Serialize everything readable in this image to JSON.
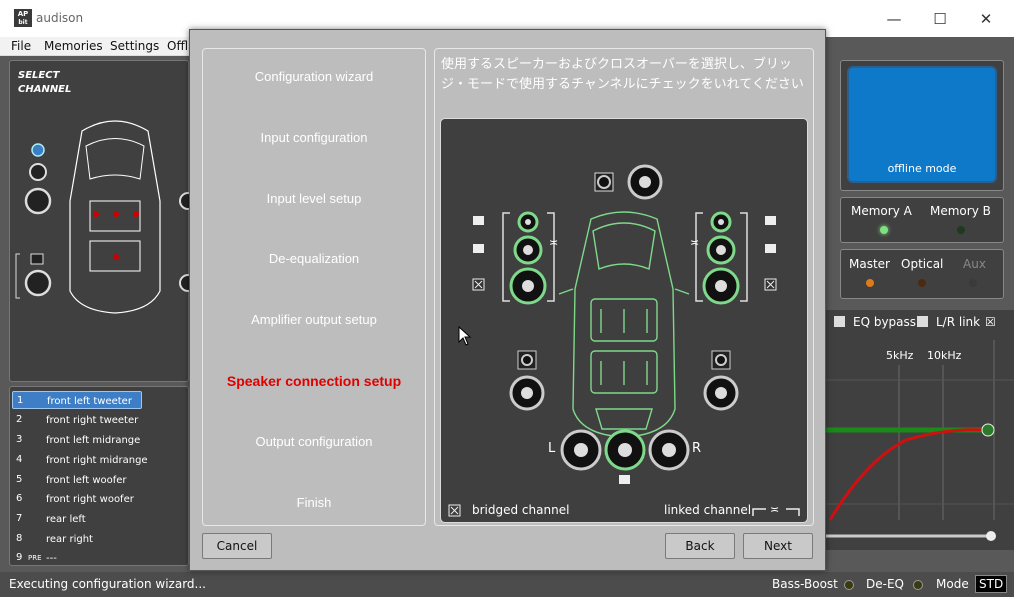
{
  "window": {
    "logo": "AP",
    "logo_sub": "bit",
    "title": "audison",
    "minimize": "—",
    "maximize": "☐",
    "close": "✕"
  },
  "menu": [
    "File",
    "Memories",
    "Settings",
    "Offli"
  ],
  "select_channel": {
    "line1": "SELECT",
    "line2": "CHANNEL"
  },
  "channels": [
    {
      "num": "1",
      "name": "front left tweeter"
    },
    {
      "num": "2",
      "name": "front right tweeter"
    },
    {
      "num": "3",
      "name": "front left midrange"
    },
    {
      "num": "4",
      "name": "front right midrange"
    },
    {
      "num": "5",
      "name": "front left woofer"
    },
    {
      "num": "6",
      "name": "front right woofer"
    },
    {
      "num": "7",
      "name": "rear left"
    },
    {
      "num": "8",
      "name": "rear right"
    },
    {
      "num": "9",
      "pre": "PRE",
      "name": "---"
    }
  ],
  "right_panel": {
    "offline": "offline mode",
    "memory_a": "Memory A",
    "memory_b": "Memory B",
    "master": "Master",
    "optical": "Optical",
    "aux": "Aux",
    "eq_bypass": "EQ bypass",
    "lr_link": "L/R link",
    "freq_5k": "5kHz",
    "freq_10k": "10kHz"
  },
  "status": {
    "message": "Executing configuration wizard...",
    "bass_boost": "Bass-Boost",
    "de_eq": "De-EQ",
    "mode": "Mode",
    "mode_value": "STD"
  },
  "wizard": {
    "steps": [
      "Configuration wizard",
      "Input configuration",
      "Input level setup",
      "De-equalization",
      "Amplifier output setup",
      "Speaker connection setup",
      "Output configuration",
      "Finish"
    ],
    "active_step": 5,
    "instruction": "使用するスピーカーおよびクロスオーバーを選択し、ブリッジ・モードで使用するチャンネルにチェックをいれてください",
    "label_l": "L",
    "label_r": "R",
    "bridged": "bridged channel",
    "linked": "linked channel",
    "cancel": "Cancel",
    "back": "Back",
    "next": "Next"
  },
  "colors": {
    "active_step": "#e00000",
    "speaker_active": "#7fd98a",
    "offline_blue": "#0f79c9"
  }
}
